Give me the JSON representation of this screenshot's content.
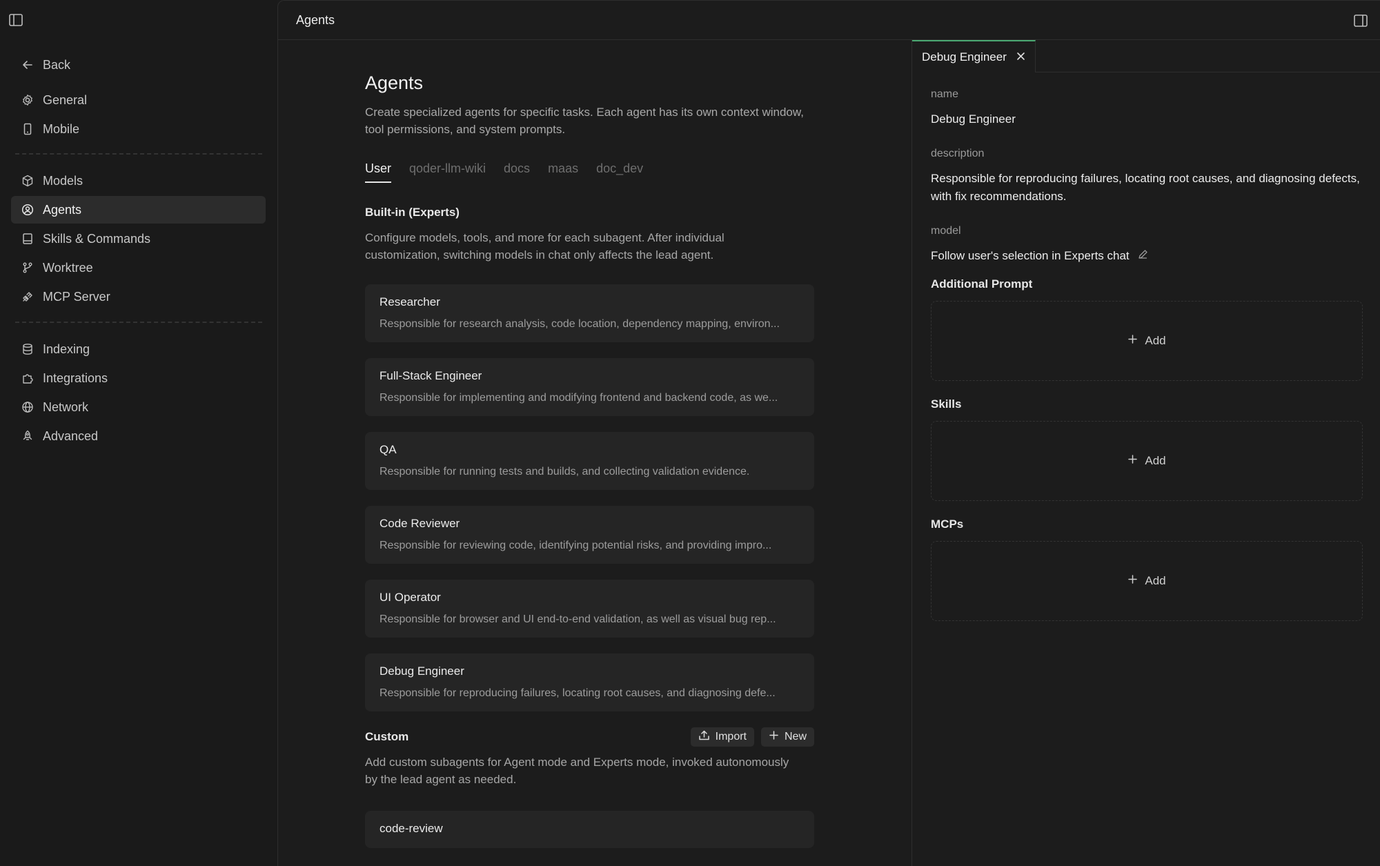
{
  "sidebar": {
    "back_label": "Back",
    "items": [
      {
        "label": "General",
        "icon": "gear-icon"
      },
      {
        "label": "Mobile",
        "icon": "mobile-icon"
      },
      {
        "label": "Models",
        "icon": "cube-icon"
      },
      {
        "label": "Agents",
        "icon": "agent-icon"
      },
      {
        "label": "Skills & Commands",
        "icon": "book-icon"
      },
      {
        "label": "Worktree",
        "icon": "branch-icon"
      },
      {
        "label": "MCP Server",
        "icon": "plug-icon"
      },
      {
        "label": "Indexing",
        "icon": "database-icon"
      },
      {
        "label": "Integrations",
        "icon": "puzzle-icon"
      },
      {
        "label": "Network",
        "icon": "globe-icon"
      },
      {
        "label": "Advanced",
        "icon": "rocket-icon"
      }
    ],
    "active": "Agents"
  },
  "topbar": {
    "title": "Agents"
  },
  "main": {
    "title": "Agents",
    "description": "Create specialized agents for specific tasks. Each agent has its own context window, tool permissions, and system prompts.",
    "tabs": [
      "User",
      "qoder-llm-wiki",
      "docs",
      "maas",
      "doc_dev"
    ],
    "active_tab": "User",
    "builtin": {
      "title": "Built-in (Experts)",
      "description": "Configure models, tools, and more for each subagent. After individual customization, switching models in chat only affects the lead agent.",
      "agents": [
        {
          "name": "Researcher",
          "desc": "Responsible for research analysis, code location, dependency mapping, environ..."
        },
        {
          "name": "Full-Stack Engineer",
          "desc": "Responsible for implementing and modifying frontend and backend code, as we..."
        },
        {
          "name": "QA",
          "desc": "Responsible for running tests and builds, and collecting validation evidence."
        },
        {
          "name": "Code Reviewer",
          "desc": "Responsible for reviewing code, identifying potential risks, and providing impro..."
        },
        {
          "name": "UI Operator",
          "desc": "Responsible for browser and UI end-to-end validation, as well as visual bug rep..."
        },
        {
          "name": "Debug Engineer",
          "desc": "Responsible for reproducing failures, locating root causes, and diagnosing defe..."
        }
      ]
    },
    "custom": {
      "title": "Custom",
      "import_label": "Import",
      "new_label": "New",
      "description": "Add custom subagents for Agent mode and Experts mode, invoked autonomously by the lead agent as needed.",
      "agents": [
        {
          "name": "code-review"
        }
      ]
    }
  },
  "detail": {
    "tab_label": "Debug Engineer",
    "name_label": "name",
    "name_value": "Debug Engineer",
    "description_label": "description",
    "description_value": "Responsible for reproducing failures, locating root causes, and diagnosing defects, with fix recommendations.",
    "model_label": "model",
    "model_value": "Follow user's selection in Experts chat",
    "additional_prompt_title": "Additional Prompt",
    "skills_title": "Skills",
    "mcps_title": "MCPs",
    "add_label": "Add"
  }
}
